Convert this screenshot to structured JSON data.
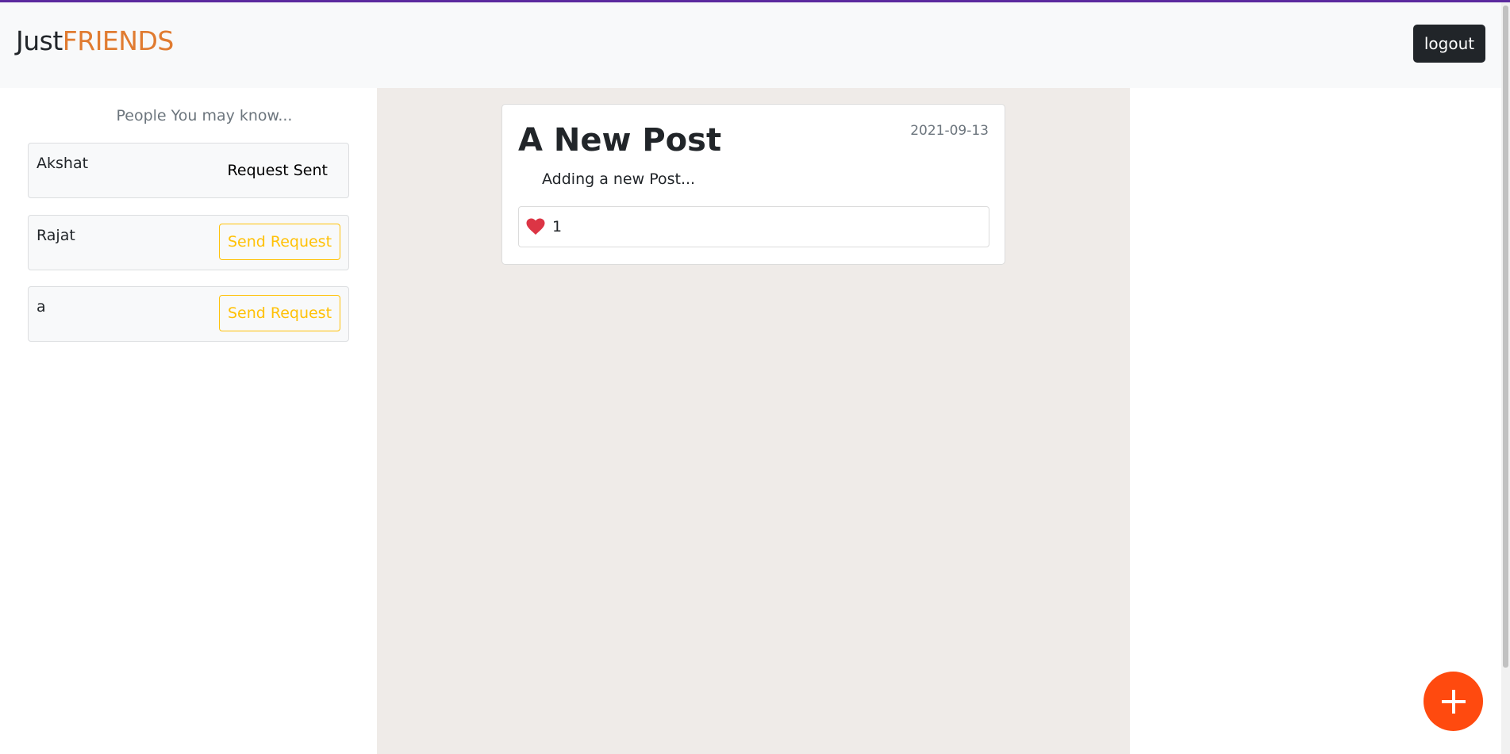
{
  "brand": {
    "part1": "Just",
    "part2": "FRIENDS"
  },
  "nav": {
    "logout_label": "logout"
  },
  "suggestions": {
    "title": "People You may know...",
    "people": [
      {
        "name": "Akshat",
        "status": "Request Sent"
      },
      {
        "name": "Rajat",
        "action": "Send Request"
      },
      {
        "name": "a",
        "action": "Send Request"
      }
    ]
  },
  "posts": [
    {
      "title": "A New Post",
      "date": "2021-09-13",
      "body": "Adding a new Post...",
      "likes": "1",
      "like_icon": "heart-icon"
    }
  ],
  "fab": {
    "icon": "plus-icon"
  },
  "colors": {
    "brand_accent": "#e07b30",
    "warning": "#ffc107",
    "fab": "#ff4a0f",
    "heart": "#dc3545",
    "feed_bg": "#efebe8",
    "top_accent": "#5b2a9e"
  }
}
